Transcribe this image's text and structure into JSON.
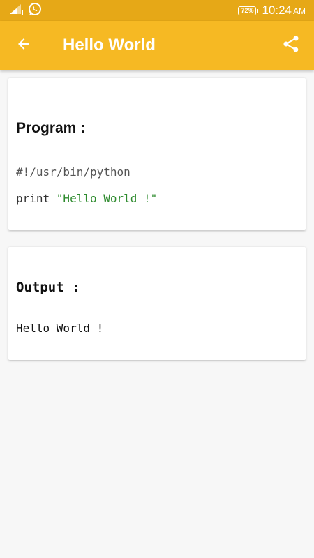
{
  "status_bar": {
    "battery": "72%",
    "time": "10:24",
    "ampm": "AM",
    "icons": [
      "signal-icon",
      "whatsapp-icon",
      "battery-icon"
    ]
  },
  "app_bar": {
    "title": "Hello World",
    "back_icon": "back-arrow-icon",
    "share_icon": "share-icon",
    "background": "#f6b923",
    "status_background": "#e6a817"
  },
  "program_card": {
    "heading": "Program :",
    "lines": [
      {
        "code": "#!/usr/bin/python"
      },
      {
        "keyword": "print ",
        "string": "\"Hello World !\""
      }
    ],
    "string_color": "#2e8b2e"
  },
  "output_card": {
    "heading": "Output :",
    "text": "Hello World !"
  }
}
